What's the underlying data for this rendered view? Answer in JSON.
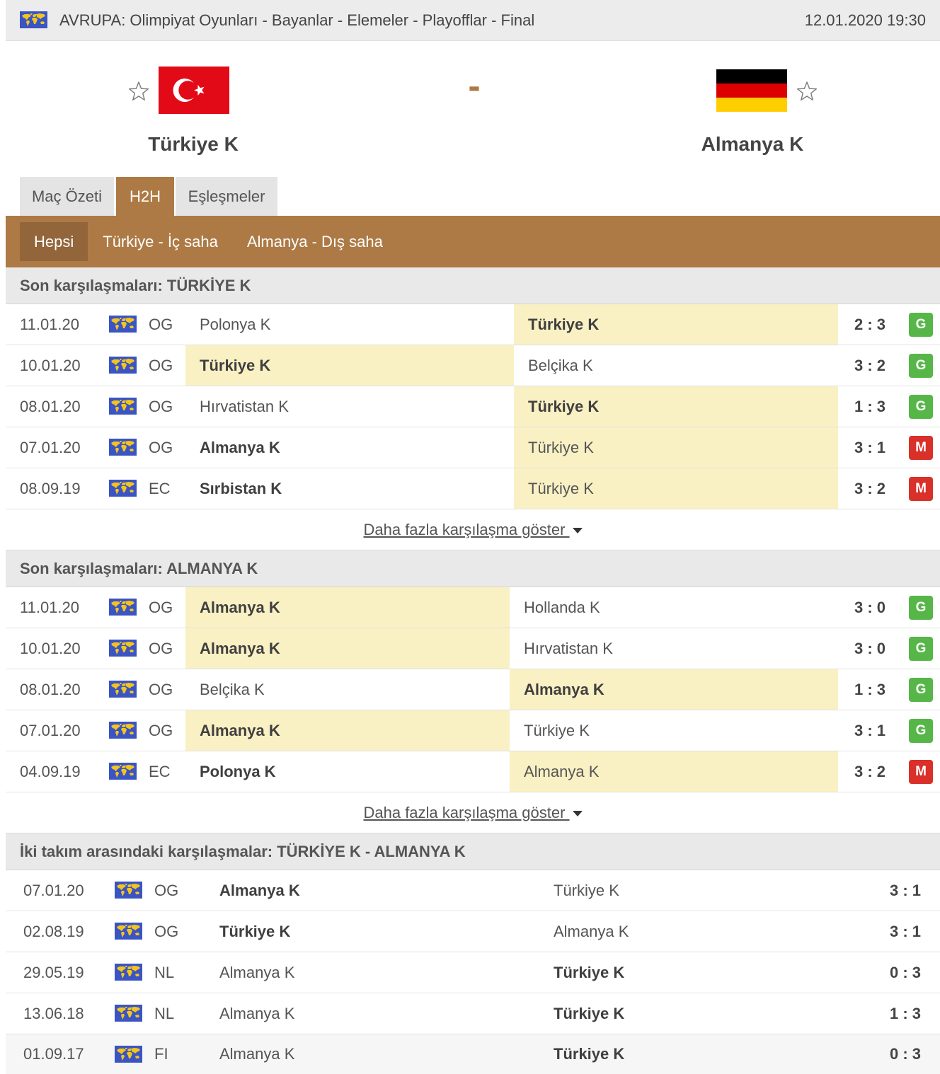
{
  "colors": {
    "brand": "#ad7a45",
    "brand_dark": "#93653a",
    "highlight": "#f9f0c4",
    "win": "#57b648",
    "loss": "#d93029",
    "world_icon_bg": "#3a54c4",
    "world_icon_land": "#f3c51c"
  },
  "icons": {
    "region": "world-flag-icon",
    "favorite": "star-outline-icon",
    "home_flag": "turkey-flag-icon",
    "away_flag": "germany-flag-icon",
    "more": "chevron-down-icon"
  },
  "header": {
    "title": "AVRUPA: Olimpiyat Oyunları - Bayanlar - Elemeler - Playofflar - Final",
    "datetime": "12.01.2020 19:30"
  },
  "match": {
    "home": {
      "name": "Türkiye K"
    },
    "away": {
      "name": "Almanya K"
    },
    "score": "-"
  },
  "tabs": [
    {
      "label": "Maç Özeti",
      "active": false
    },
    {
      "label": "H2H",
      "active": true
    },
    {
      "label": "Eşleşmeler",
      "active": false
    }
  ],
  "subtabs": [
    {
      "label": "Hepsi",
      "active": true
    },
    {
      "label": "Türkiye - İç saha",
      "active": false
    },
    {
      "label": "Almanya - Dış saha",
      "active": false
    }
  ],
  "sections": [
    {
      "title": "Son karşılaşmaları: TÜRKİYE K",
      "more_link": "Daha fazla karşılaşma göster",
      "rows": [
        {
          "date": "11.01.20",
          "competition": "OG",
          "home": "Polonya K",
          "away": "Türkiye K",
          "score": "2 : 3",
          "result": "G",
          "home_winner": false,
          "away_winner": true,
          "home_highlight": false,
          "away_highlight": true
        },
        {
          "date": "10.01.20",
          "competition": "OG",
          "home": "Türkiye K",
          "away": "Belçika K",
          "score": "3 : 2",
          "result": "G",
          "home_winner": true,
          "away_winner": false,
          "home_highlight": true,
          "away_highlight": false
        },
        {
          "date": "08.01.20",
          "competition": "OG",
          "home": "Hırvatistan K",
          "away": "Türkiye K",
          "score": "1 : 3",
          "result": "G",
          "home_winner": false,
          "away_winner": true,
          "home_highlight": false,
          "away_highlight": true
        },
        {
          "date": "07.01.20",
          "competition": "OG",
          "home": "Almanya K",
          "away": "Türkiye K",
          "score": "3 : 1",
          "result": "M",
          "home_winner": true,
          "away_winner": false,
          "home_highlight": false,
          "away_highlight": true
        },
        {
          "date": "08.09.19",
          "competition": "EC",
          "home": "Sırbistan K",
          "away": "Türkiye K",
          "score": "3 : 2",
          "result": "M",
          "home_winner": true,
          "away_winner": false,
          "home_highlight": false,
          "away_highlight": true
        }
      ]
    },
    {
      "title": "Son karşılaşmaları: ALMANYA K",
      "more_link": "Daha fazla karşılaşma göster",
      "rows": [
        {
          "date": "11.01.20",
          "competition": "OG",
          "home": "Almanya K",
          "away": "Hollanda K",
          "score": "3 : 0",
          "result": "G",
          "home_winner": true,
          "away_winner": false,
          "home_highlight": true,
          "away_highlight": false
        },
        {
          "date": "10.01.20",
          "competition": "OG",
          "home": "Almanya K",
          "away": "Hırvatistan K",
          "score": "3 : 0",
          "result": "G",
          "home_winner": true,
          "away_winner": false,
          "home_highlight": true,
          "away_highlight": false
        },
        {
          "date": "08.01.20",
          "competition": "OG",
          "home": "Belçika K",
          "away": "Almanya K",
          "score": "1 : 3",
          "result": "G",
          "home_winner": false,
          "away_winner": true,
          "home_highlight": false,
          "away_highlight": true
        },
        {
          "date": "07.01.20",
          "competition": "OG",
          "home": "Almanya K",
          "away": "Türkiye K",
          "score": "3 : 1",
          "result": "G",
          "home_winner": true,
          "away_winner": false,
          "home_highlight": true,
          "away_highlight": false
        },
        {
          "date": "04.09.19",
          "competition": "EC",
          "home": "Polonya K",
          "away": "Almanya K",
          "score": "3 : 2",
          "result": "M",
          "home_winner": true,
          "away_winner": false,
          "home_highlight": false,
          "away_highlight": true
        }
      ]
    },
    {
      "title": "İki takım arasındaki karşılaşmalar: TÜRKİYE K - ALMANYA K",
      "rows": [
        {
          "date": "07.01.20",
          "competition": "OG",
          "home": "Almanya K",
          "away": "Türkiye K",
          "score": "3 : 1",
          "home_winner": true,
          "away_winner": false
        },
        {
          "date": "02.08.19",
          "competition": "OG",
          "home": "Türkiye K",
          "away": "Almanya K",
          "score": "3 : 1",
          "home_winner": true,
          "away_winner": false
        },
        {
          "date": "29.05.19",
          "competition": "NL",
          "home": "Almanya K",
          "away": "Türkiye K",
          "score": "0 : 3",
          "home_winner": false,
          "away_winner": true
        },
        {
          "date": "13.06.18",
          "competition": "NL",
          "home": "Almanya K",
          "away": "Türkiye K",
          "score": "1 : 3",
          "home_winner": false,
          "away_winner": true
        },
        {
          "date": "01.09.17",
          "competition": "FI",
          "home": "Almanya K",
          "away": "Türkiye K",
          "score": "0 : 3",
          "home_winner": false,
          "away_winner": true,
          "hover": true
        }
      ]
    }
  ]
}
